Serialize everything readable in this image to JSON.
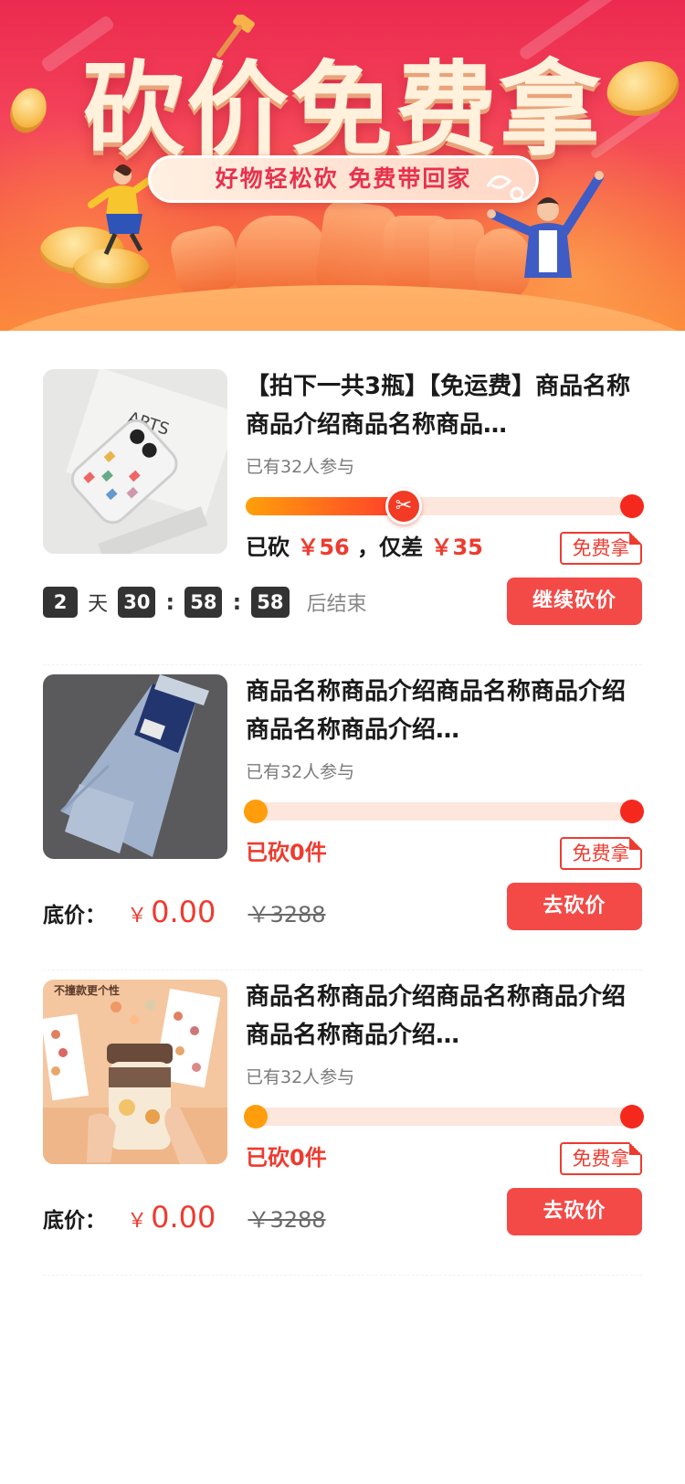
{
  "banner": {
    "title": "砍价免费拿",
    "slogan": "好物轻松砍 免费带回家"
  },
  "colors": {
    "accent": "#ee3b2f",
    "button": "#f34a47",
    "progress_start": "#ff9f0a",
    "progress_end": "#ff3b2c"
  },
  "items": [
    {
      "name": "【拍下一共3瓶】【免运费】商品名称商品介绍商品名称商品…",
      "participants": "已有32人参与",
      "progress": 0.38,
      "status_prefix": "已砍",
      "cut_amount": "￥56",
      "status_mid": "，仅差",
      "remaining": "￥35",
      "badge": "免费拿",
      "countdown": {
        "days": "2",
        "day_unit": "天",
        "hours": "30",
        "minutes": "58",
        "seconds": "58",
        "sep": ":",
        "suffix": "后结束"
      },
      "button": "继续砍价",
      "image": "phone-case"
    },
    {
      "name": "商品名称商品介绍商品名称商品介绍商品名称商品介绍…",
      "participants": "已有32人参与",
      "progress": 0,
      "status": "已砍0件",
      "badge": "免费拿",
      "price_label": "底价：",
      "yen": "￥",
      "price_now": "0.00",
      "price_old": "￥3288",
      "button": "去砍价",
      "image": "jeans"
    },
    {
      "name": "商品名称商品介绍商品名称商品介绍商品名称商品介绍…",
      "participants": "已有32人参与",
      "progress": 0,
      "status": "已砍0件",
      "badge": "免费拿",
      "price_label": "底价：",
      "yen": "￥",
      "price_now": "0.00",
      "price_old": "￥3288",
      "button": "去砍价",
      "image": "cup",
      "image_caption": "不撞款更个性"
    }
  ]
}
